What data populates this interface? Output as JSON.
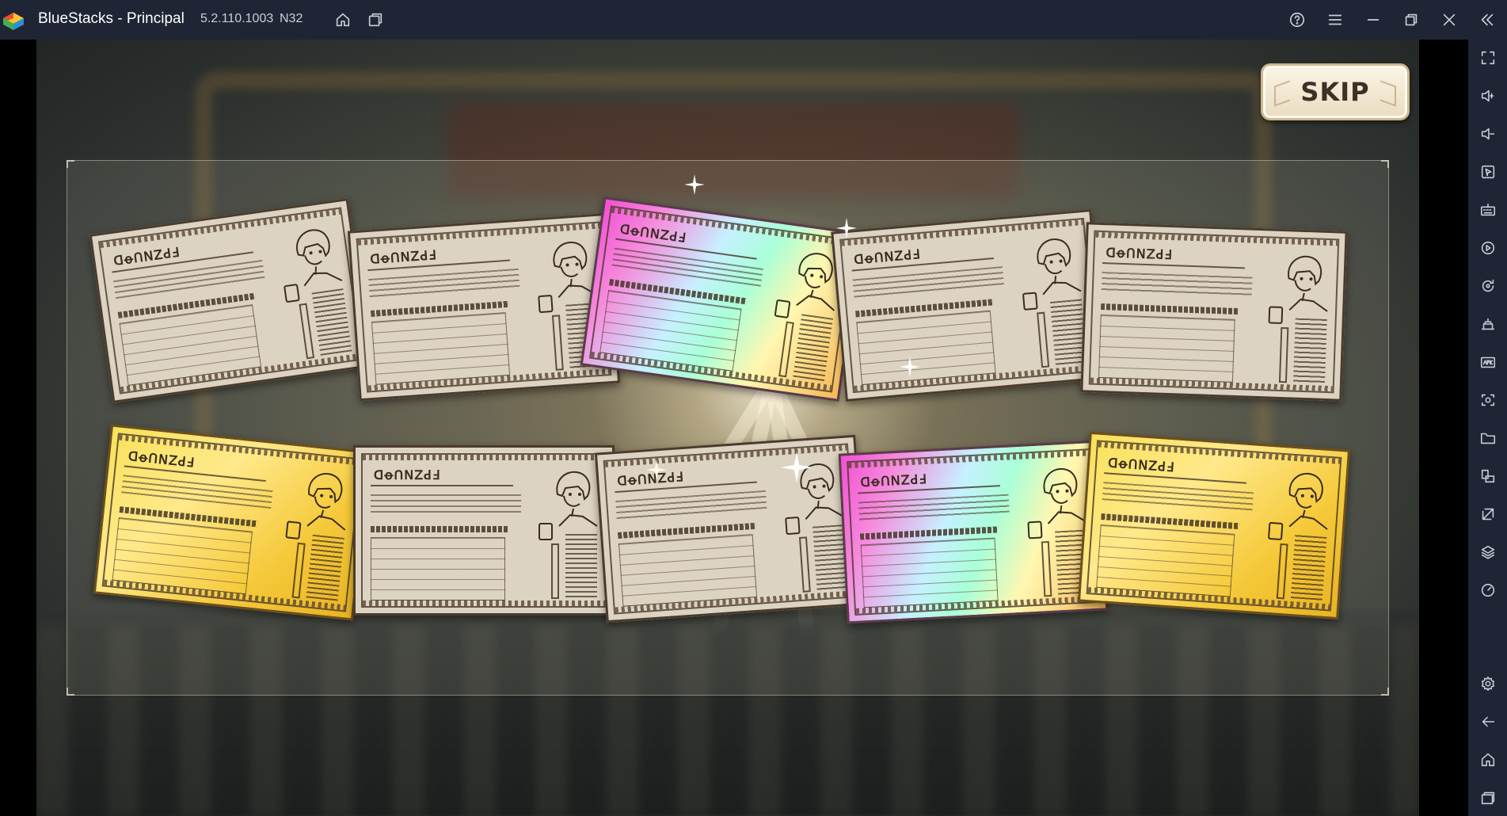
{
  "window": {
    "title": "BlueStacks - Principal",
    "version": "5.2.110.1003",
    "build": "N32"
  },
  "titlebar_icons": [
    "home-icon",
    "multi-instance-icon",
    "help-icon",
    "menu-icon",
    "minimize-icon",
    "restore-icon",
    "close-icon",
    "collapse-sidebar-icon"
  ],
  "sidebar_icons": [
    "fullscreen-icon",
    "volume-up-icon",
    "volume-down-icon",
    "pointer-icon",
    "keyboard-icon",
    "macro-play-icon",
    "rotate-icon",
    "game-controls-icon",
    "apk-install-icon",
    "screenshot-icon",
    "folder-icon",
    "multi-window-icon",
    "eco-mode-icon",
    "layers-icon",
    "performance-icon",
    "settings-icon",
    "back-icon",
    "home-icon",
    "recents-icon"
  ],
  "game": {
    "skip_label": "SKIP",
    "card_glyph_text": "ꓷꝋꓵꓠꓜꓒꓞ",
    "cards": [
      {
        "row": 1,
        "rarity": "common"
      },
      {
        "row": 1,
        "rarity": "common"
      },
      {
        "row": 1,
        "rarity": "rainbow"
      },
      {
        "row": 1,
        "rarity": "common"
      },
      {
        "row": 1,
        "rarity": "common"
      },
      {
        "row": 2,
        "rarity": "gold"
      },
      {
        "row": 2,
        "rarity": "common"
      },
      {
        "row": 2,
        "rarity": "common"
      },
      {
        "row": 2,
        "rarity": "rainbow"
      },
      {
        "row": 2,
        "rarity": "gold"
      }
    ]
  },
  "colors": {
    "chrome": "#1f2535",
    "icon": "#c9cedb",
    "card_plain": "#ddd3c2",
    "card_gold": "#f9e15a",
    "card_rainbow": "#f24fd3",
    "skip_text": "#3e3026"
  }
}
